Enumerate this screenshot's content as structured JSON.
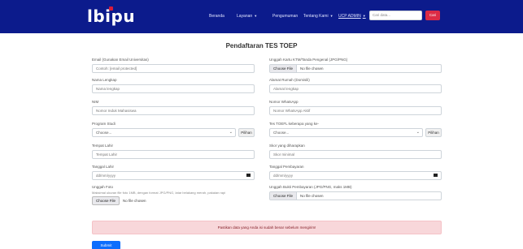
{
  "nav": {
    "logo": "lbipu",
    "items": [
      "Beranda",
      "Layanan",
      "Pengumuman",
      "Tentang Kami"
    ],
    "ucp": "UCP ADMIN",
    "search_placeholder": "Cari data...",
    "search_button": "Cari"
  },
  "page": {
    "title": "Pendaftaran TES TOEP"
  },
  "form": {
    "left": {
      "email": {
        "label": "Email (Gunakan Email Universitas)",
        "placeholder": "Contoh: [email protected]"
      },
      "name": {
        "label": "Nama Lengkap",
        "placeholder": "Nama lengkap"
      },
      "nim": {
        "label": "NIM",
        "placeholder": "Nomor Induk Mahasiswa"
      },
      "prodi": {
        "label": "Program Studi",
        "value": "Choose...",
        "button": "Pilihan"
      },
      "birthplace": {
        "label": "Tempat Lahir",
        "placeholder": "Tempat Lahir"
      },
      "birthdate": {
        "label": "Tanggal Lahir",
        "value": "dd/mm/yyyy"
      },
      "photo": {
        "label": "Unggah Foto",
        "help": "Maksimal ukuran file foto 1MB, dengan format JPG/PNG, latar belakang merah, pakaian rapi",
        "button": "Choose File",
        "status": "No file chosen"
      }
    },
    "right": {
      "ktm": {
        "label": "Unggah Kartu KTM/Tanda Pengenal (JPG/PNG)",
        "button": "Choose File",
        "status": "No file chosen"
      },
      "address": {
        "label": "Alamat Rumah (Domisili)",
        "placeholder": "Alamat lengkap"
      },
      "whatsapp": {
        "label": "Nomor WhatsApp",
        "placeholder": "Nomor WhatsApp Aktif"
      },
      "toefl_count": {
        "label": "Tes TOEFL keberapa yang ke-",
        "value": "Choose...",
        "button": "Pilihan"
      },
      "score": {
        "label": "Skor yang diharapkan",
        "placeholder": "Skor minimal"
      },
      "paydate": {
        "label": "Tanggal Pembayaran",
        "value": "dd/mm/yyyy"
      },
      "proof": {
        "label": "Unggah Bukti Pembayaran (JPG/PNG, maks 1MB)",
        "button": "Choose File",
        "status": "No file chosen"
      }
    },
    "alert": "Pastikan data yang Anda isi sudah benar sebelum mengirim!",
    "submit": "Submit"
  },
  "colors": {
    "navbar": "#0c1b8c",
    "accent": "#dc2b45",
    "primary": "#0d6efd",
    "alert_bg": "#f8d7da"
  }
}
